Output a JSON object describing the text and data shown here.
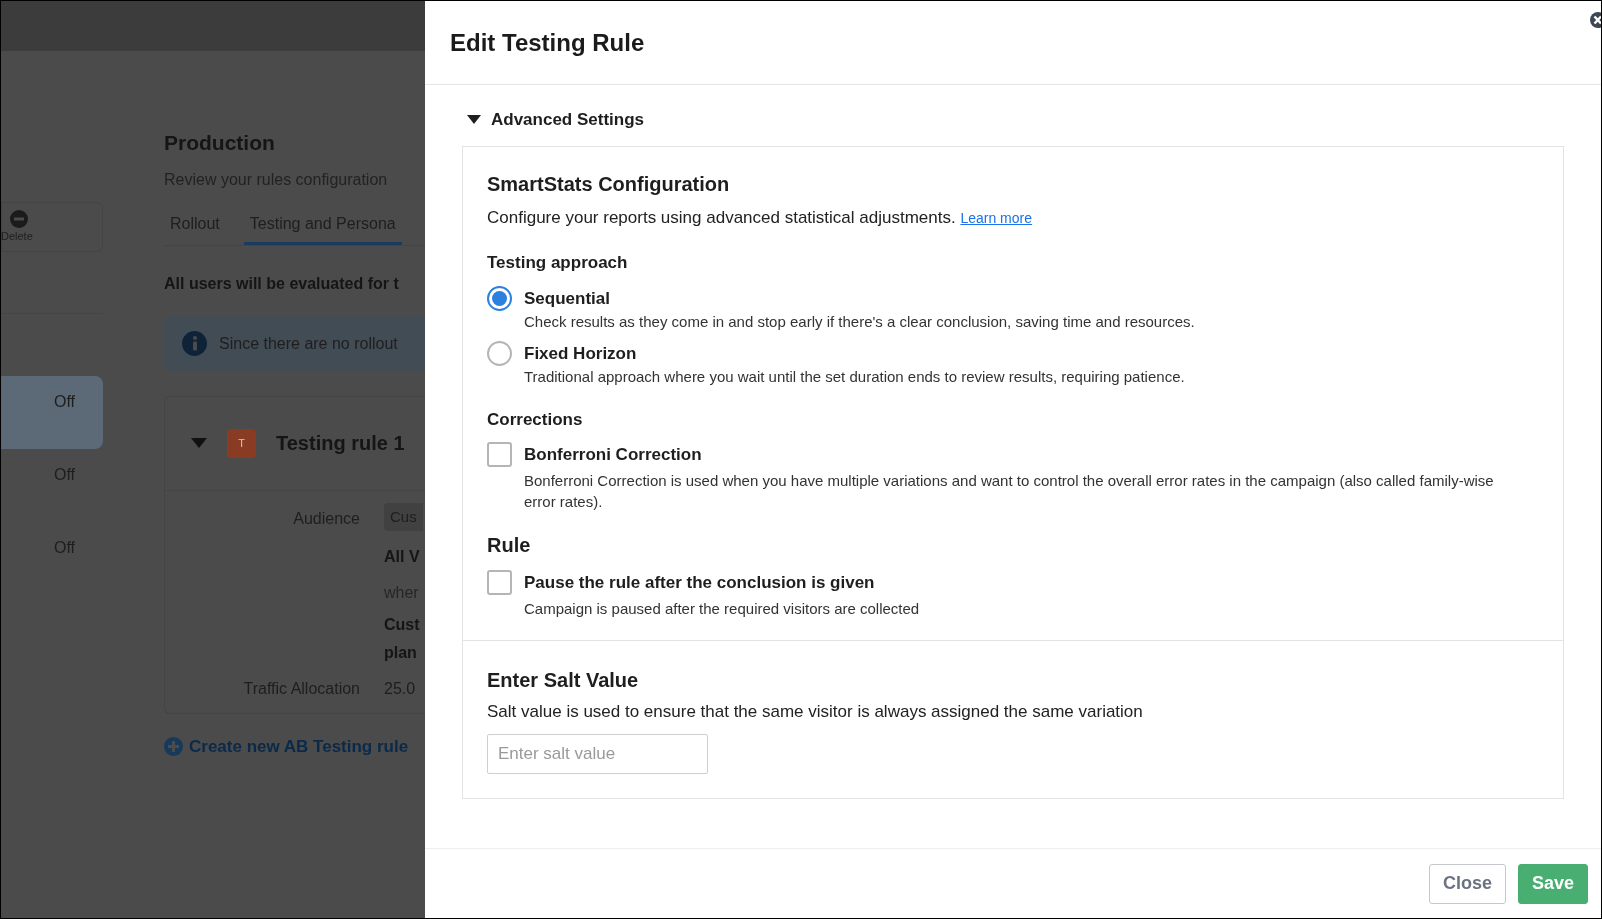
{
  "background": {
    "delete_label": "Delete",
    "off_items": [
      {
        "label": "Off",
        "selected": true
      },
      {
        "label": "Off",
        "selected": false
      },
      {
        "label": "Off",
        "selected": false
      }
    ],
    "title": "Production",
    "subtitle": "Review your rules configuration",
    "tabs": [
      {
        "label": "Rollout",
        "selected": false
      },
      {
        "label": "Testing and Persona",
        "selected": true
      }
    ],
    "notice": "All users will be evaluated for t",
    "info": "Since there are no rollout",
    "rule": {
      "badge": "T",
      "name": "Testing rule 1",
      "expanded": true,
      "audience_label": "Audience",
      "audience_tag": "Cus",
      "audience_lines": [
        {
          "text": "All V",
          "bold": true
        },
        {
          "text": "wher",
          "bold": false
        },
        {
          "text": "Cust",
          "bold": true
        },
        {
          "text": "plan",
          "bold": true
        }
      ],
      "traffic_label": "Traffic Allocation",
      "traffic_value": "25.0"
    },
    "create_link": "Create new AB Testing rule"
  },
  "panel": {
    "title": "Edit Testing Rule",
    "section": {
      "label": "Advanced Settings",
      "expanded": true
    },
    "smartstats": {
      "heading": "SmartStats Configuration",
      "description": "Configure your reports using advanced statistical adjustments.",
      "link": "Learn more"
    },
    "approach": {
      "heading": "Testing approach",
      "options": [
        {
          "label": "Sequential",
          "description": "Check results as they come in and stop early if there's a clear conclusion, saving time and resources.",
          "selected": true
        },
        {
          "label": "Fixed Horizon",
          "description": "Traditional approach where you wait until the set duration ends to review results, requiring patience.",
          "selected": false
        }
      ]
    },
    "corrections": {
      "heading": "Corrections",
      "items": [
        {
          "label": "Bonferroni Correction",
          "description": "Bonferroni Correction is used when you have multiple variations and want to control the overall error rates in the campaign (also called family-wise error rates).",
          "checked": false
        }
      ]
    },
    "rule": {
      "heading": "Rule",
      "items": [
        {
          "label": "Pause the rule after the conclusion is given",
          "description": "Campaign is paused after the required visitors are collected",
          "checked": false
        }
      ]
    },
    "salt": {
      "heading": "Enter Salt Value",
      "description": "Salt value is used to ensure that the same visitor is always assigned the same variation",
      "placeholder": "Enter salt value"
    },
    "buttons": [
      {
        "label": "Close",
        "kind": "secondary"
      },
      {
        "label": "Save",
        "kind": "primary"
      }
    ]
  }
}
